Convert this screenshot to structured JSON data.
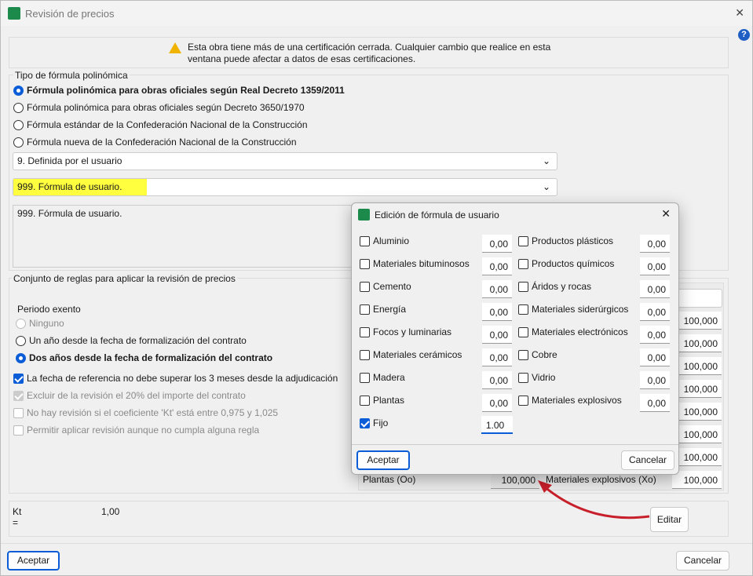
{
  "window": {
    "title": "Revisión de precios",
    "close": "✕",
    "help": "?"
  },
  "warning": {
    "line1": "Esta obra tiene más de una certificación cerrada. Cualquier cambio que realice en esta",
    "line2": "ventana puede afectar a datos de esas certificaciones."
  },
  "formula_type": {
    "legend": "Tipo de fórmula polinómica",
    "options": [
      "Fórmula polinómica para obras oficiales según Real Decreto 1359/2011",
      "Fórmula polinómica para obras oficiales según Decreto 3650/1970",
      "Fórmula estándar de la Confederación Nacional de la Construcción",
      "Fórmula nueva de la Confederación Nacional de la Construcción"
    ],
    "selected": 0,
    "combo1": "9. Definida por el usuario",
    "combo2": "999. Fórmula de usuario.",
    "description": "999. Fórmula de usuario."
  },
  "rules": {
    "legend": "Conjunto de reglas para aplicar la revisión de precios",
    "period_label": "Periodo exento",
    "periods": [
      "Ninguno",
      "Un año desde la fecha de formalización del contrato",
      "Dos años desde la fecha de formalización del contrato"
    ],
    "period_selected": 2,
    "checks": [
      {
        "label": "La fecha de referencia no debe superar los 3 meses desde la adjudicación",
        "checked": true,
        "enabled": true
      },
      {
        "label": "Excluir de la revisión el 20% del importe del contrato",
        "checked": true,
        "enabled": false
      },
      {
        "label": "No hay revisión si el coeficiente 'Kt' está entre 0,975 y 1,025",
        "checked": false,
        "enabled": false
      },
      {
        "label": "Permitir aplicar revisión aunque no cumpla alguna regla",
        "checked": false,
        "enabled": false
      }
    ]
  },
  "indices": {
    "values": [
      "100,000",
      "100,000",
      "100,000",
      "100,000",
      "100,000",
      "100,000",
      "100,000"
    ],
    "last_row": {
      "label1": "Plantas (Oo)",
      "value1": "100,000",
      "label2": "Materiales explosivos (Xo)",
      "value2": "100,000"
    }
  },
  "kt": {
    "label": "Kt",
    "eq": "=",
    "value": "1,00"
  },
  "edit_button": "Editar",
  "footer": {
    "accept": "Aceptar",
    "cancel": "Cancelar"
  },
  "dialog": {
    "title": "Edición de fórmula de usuario",
    "close": "✕",
    "left": [
      {
        "label": "Aluminio",
        "value": "0,00"
      },
      {
        "label": "Materiales bituminosos",
        "value": "0,00"
      },
      {
        "label": "Cemento",
        "value": "0,00"
      },
      {
        "label": "Energía",
        "value": "0,00"
      },
      {
        "label": "Focos y luminarias",
        "value": "0,00"
      },
      {
        "label": "Materiales cerámicos",
        "value": "0,00"
      },
      {
        "label": "Madera",
        "value": "0,00"
      },
      {
        "label": "Plantas",
        "value": "0,00"
      }
    ],
    "right": [
      {
        "label": "Productos plásticos",
        "value": "0,00"
      },
      {
        "label": "Productos químicos",
        "value": "0,00"
      },
      {
        "label": "Áridos y rocas",
        "value": "0,00"
      },
      {
        "label": "Materiales siderúrgicos",
        "value": "0,00"
      },
      {
        "label": "Materiales electrónicos",
        "value": "0,00"
      },
      {
        "label": "Cobre",
        "value": "0,00"
      },
      {
        "label": "Vidrio",
        "value": "0,00"
      },
      {
        "label": "Materiales explosivos",
        "value": "0,00"
      }
    ],
    "fixed": {
      "label": "Fijo",
      "value": "1.00",
      "checked": true
    },
    "accept": "Aceptar",
    "cancel": "Cancelar"
  },
  "colors": {
    "accent": "#0b5cd7",
    "highlight": "#ffff40",
    "arrow": "#c8202a"
  }
}
